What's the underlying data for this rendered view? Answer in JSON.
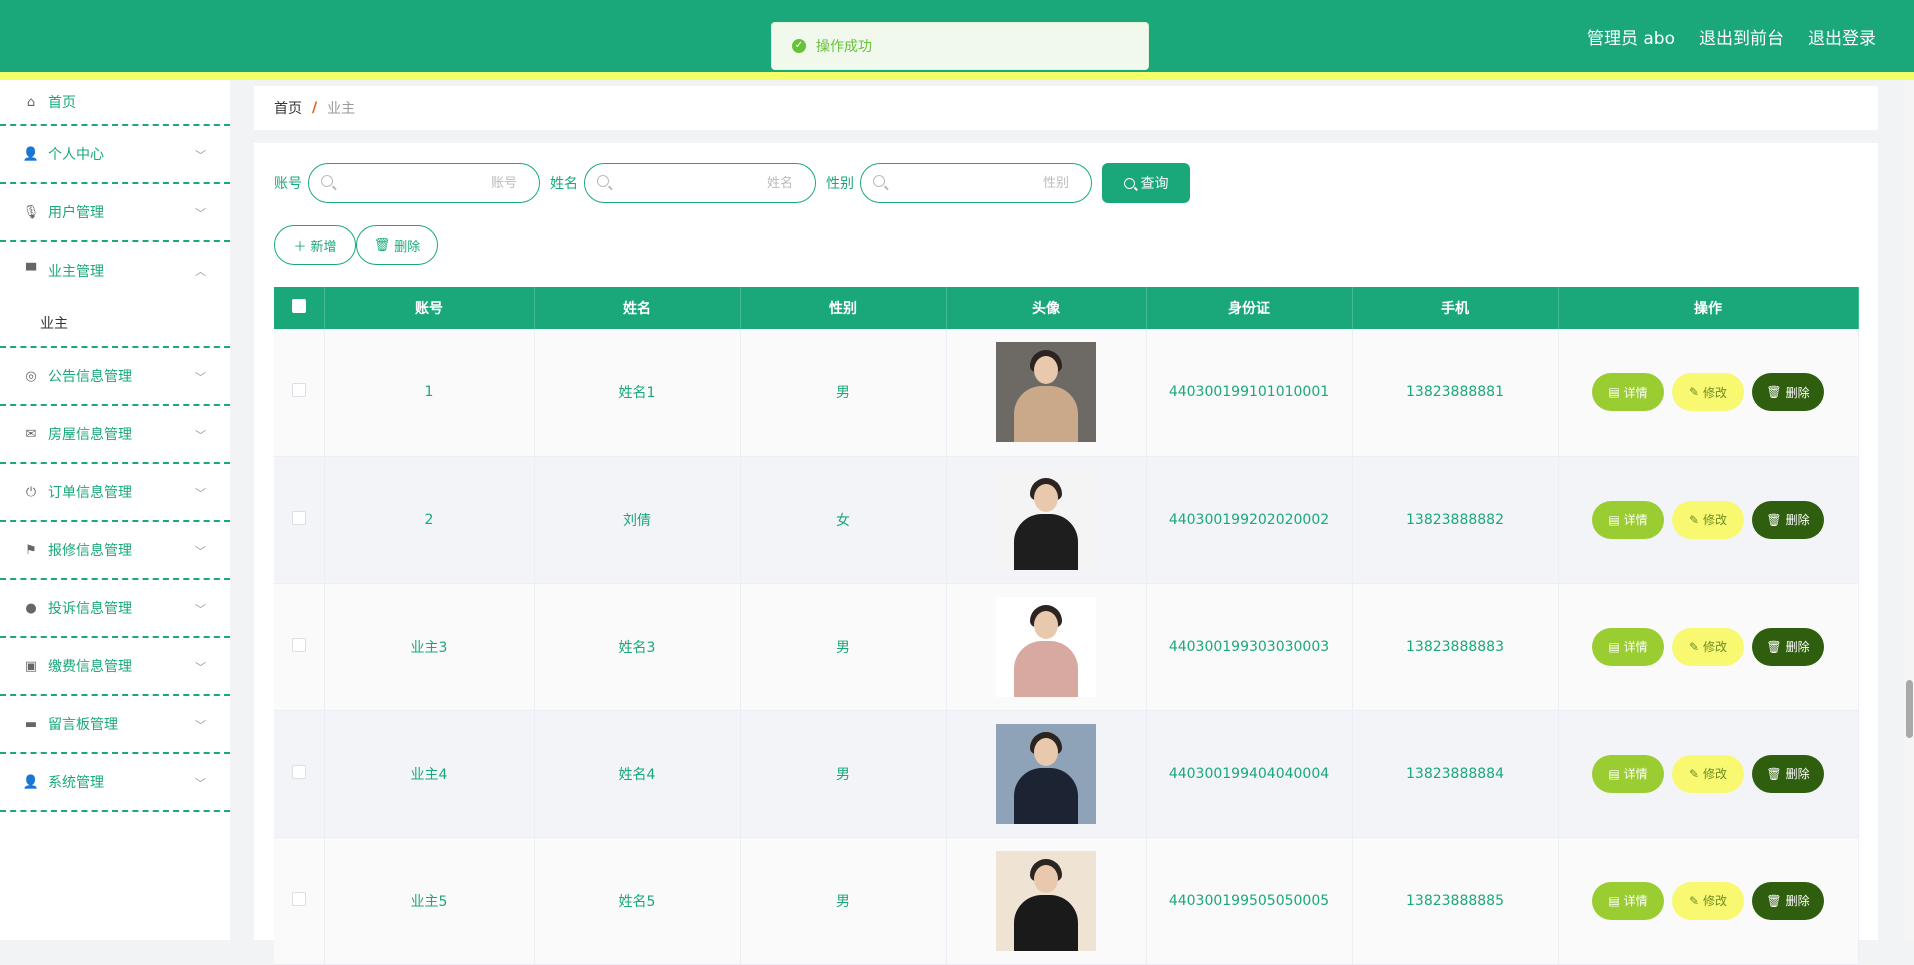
{
  "header": {
    "toast": "操作成功",
    "admin": "管理员 abo",
    "to_front": "退出到前台",
    "logout": "退出登录",
    "color": "#1aa87a"
  },
  "sidebar": {
    "items": [
      {
        "label": "首页",
        "icon": "home-icon"
      },
      {
        "label": "个人中心",
        "icon": "user-icon"
      },
      {
        "label": "用户管理",
        "icon": "microphone-icon"
      },
      {
        "label": "业主管理",
        "icon": "flag-pole-icon"
      },
      {
        "label": "公告信息管理",
        "icon": "dial-icon"
      },
      {
        "label": "房屋信息管理",
        "icon": "mail-icon"
      },
      {
        "label": "订单信息管理",
        "icon": "power-icon"
      },
      {
        "label": "报修信息管理",
        "icon": "flag-icon"
      },
      {
        "label": "投诉信息管理",
        "icon": "balloon-icon"
      },
      {
        "label": "缴费信息管理",
        "icon": "clipboard-icon"
      },
      {
        "label": "留言板管理",
        "icon": "monitor-icon"
      },
      {
        "label": "系统管理",
        "icon": "admin-icon"
      }
    ],
    "sub_owner": "业主"
  },
  "breadcrumb": {
    "home": "首页",
    "sep": "/",
    "current": "业主"
  },
  "search": {
    "account_label": "账号",
    "account_placeholder": "账号",
    "name_label": "姓名",
    "name_placeholder": "姓名",
    "gender_label": "性别",
    "gender_placeholder": "性别",
    "query": "查询"
  },
  "actions": {
    "add": "新增",
    "delete": "删除"
  },
  "table": {
    "headers": [
      "账号",
      "姓名",
      "性别",
      "头像",
      "身份证",
      "手机",
      "操作"
    ],
    "rows": [
      {
        "account": "1",
        "name": "姓名1",
        "gender": "男",
        "id_card": "440300199101010001",
        "phone": "13823888881"
      },
      {
        "account": "2",
        "name": "刘倩",
        "gender": "女",
        "id_card": "440300199202020002",
        "phone": "13823888882"
      },
      {
        "account": "业主3",
        "name": "姓名3",
        "gender": "男",
        "id_card": "440300199303030003",
        "phone": "13823888883"
      },
      {
        "account": "业主4",
        "name": "姓名4",
        "gender": "男",
        "id_card": "440300199404040004",
        "phone": "13823888884"
      },
      {
        "account": "业主5",
        "name": "姓名5",
        "gender": "男",
        "id_card": "440300199505050005",
        "phone": "13823888885"
      }
    ],
    "op_detail": "详情",
    "op_edit": "修改",
    "op_delete": "删除"
  }
}
